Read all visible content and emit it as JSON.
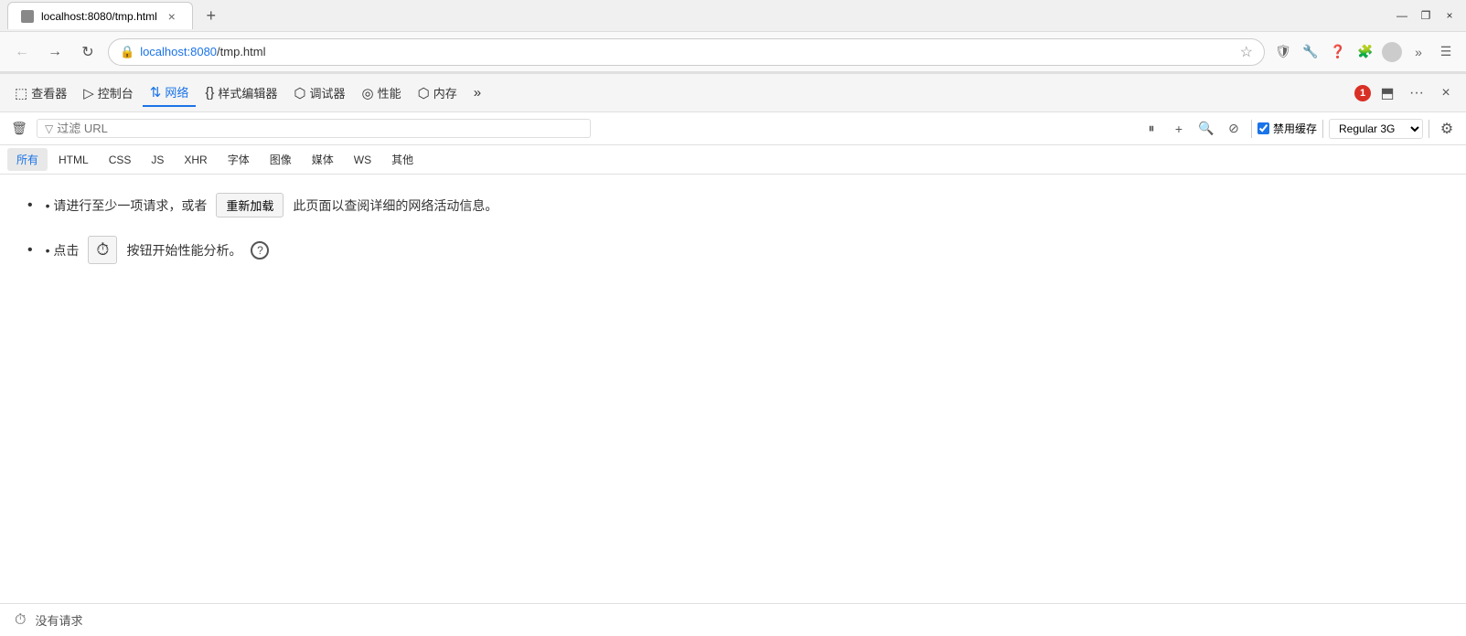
{
  "browser": {
    "tab_title": "localhost:8080/tmp.html",
    "tab_close": "×",
    "tab_new": "+",
    "url": "localhost:8080/tmp.html",
    "url_colored": "localhost:8080",
    "url_path": "/tmp.html",
    "win_minimize": "—",
    "win_restore": "❐",
    "win_close": "×"
  },
  "devtools": {
    "tools": [
      {
        "id": "inspector",
        "icon": "⬚",
        "label": "查看器"
      },
      {
        "id": "console",
        "icon": "▷",
        "label": "控制台"
      },
      {
        "id": "network",
        "icon": "↑↓",
        "label": "网络",
        "active": true
      },
      {
        "id": "style-editor",
        "icon": "{}",
        "label": "样式编辑器"
      },
      {
        "id": "debugger",
        "icon": "⬡",
        "label": "调试器"
      },
      {
        "id": "performance",
        "icon": "◎",
        "label": "性能"
      },
      {
        "id": "memory",
        "icon": "⬡",
        "label": "内存"
      },
      {
        "id": "more",
        "icon": "»",
        "label": ""
      }
    ],
    "error_count": "1",
    "dock_btn": "⬒",
    "more_btn": "···",
    "close_btn": "×"
  },
  "network": {
    "toolbar": {
      "clear_btn": "🗑",
      "filter_placeholder": "过滤 URL",
      "pause_btn": "⏸",
      "add_btn": "+",
      "search_btn": "🔍",
      "block_btn": "⊘",
      "disable_cache_label": "禁用缓存",
      "throttle_value": "Regular 3G ⬦",
      "settings_btn": "⚙"
    },
    "filter_tabs": [
      "所有",
      "HTML",
      "CSS",
      "JS",
      "XHR",
      "字体",
      "图像",
      "媒体",
      "WS",
      "其他"
    ],
    "active_tab": "所有",
    "message1_pre": "• 请进行至少一项请求，或者",
    "message1_reload": "重新加载",
    "message1_post": "此页面以查阅详细的网络活动信息。",
    "message2_pre": "• 点击",
    "message2_post": "按钮开始性能分析。",
    "status_icon": "⏱",
    "status_text": "没有请求"
  }
}
